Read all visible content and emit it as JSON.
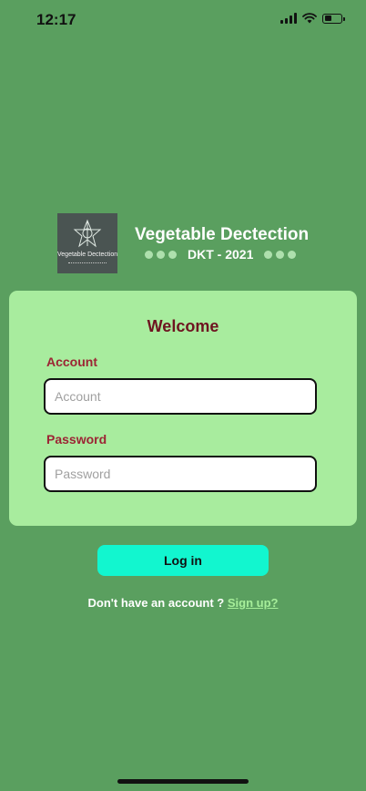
{
  "status_bar": {
    "time": "12:17",
    "battery_level": 0.35
  },
  "brand": {
    "logo_text": "Vegetable Dectection",
    "title": "Vegetable Dectection",
    "subtitle": "DKT - 2021"
  },
  "login_card": {
    "welcome": "Welcome",
    "account_label": "Account",
    "account_placeholder": "Account",
    "account_value": "",
    "password_label": "Password",
    "password_placeholder": "Password",
    "password_value": ""
  },
  "actions": {
    "login_label": "Log in",
    "signup_prompt": "Don't have an account ?",
    "signup_link": "Sign up?"
  },
  "colors": {
    "background": "#5a9f5f",
    "card": "#a8ec9e",
    "welcome_text": "#6e1420",
    "label_text": "#9c2434",
    "login_button": "#12f6cf",
    "signup_link": "#a6ee9a"
  },
  "icons": [
    "signal-icon",
    "wifi-icon",
    "battery-icon",
    "logo-icon"
  ]
}
